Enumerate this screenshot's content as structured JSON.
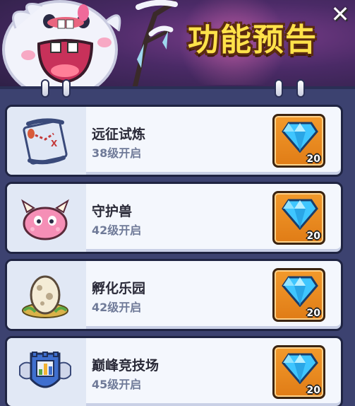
{
  "header": {
    "title": "功能预告",
    "close_symbol": "✕"
  },
  "features": [
    {
      "name": "远征试炼",
      "unlock": "38级开启",
      "icon": "scroll-map-icon",
      "reward_icon": "diamond-icon",
      "reward_count": "20"
    },
    {
      "name": "守护兽",
      "unlock": "42级开启",
      "icon": "pink-monster-icon",
      "reward_icon": "diamond-icon",
      "reward_count": "20"
    },
    {
      "name": "孵化乐园",
      "unlock": "42级开启",
      "icon": "egg-nest-icon",
      "reward_icon": "diamond-icon",
      "reward_count": "20"
    },
    {
      "name": "巅峰竞技场",
      "unlock": "45级开启",
      "icon": "arena-shield-icon",
      "reward_icon": "diamond-icon",
      "reward_count": "20"
    }
  ],
  "colors": {
    "title": "#ffe24a",
    "panel": "#3c4270",
    "reward_bg": "#f29a2c",
    "gem": "#3fc6ff"
  }
}
